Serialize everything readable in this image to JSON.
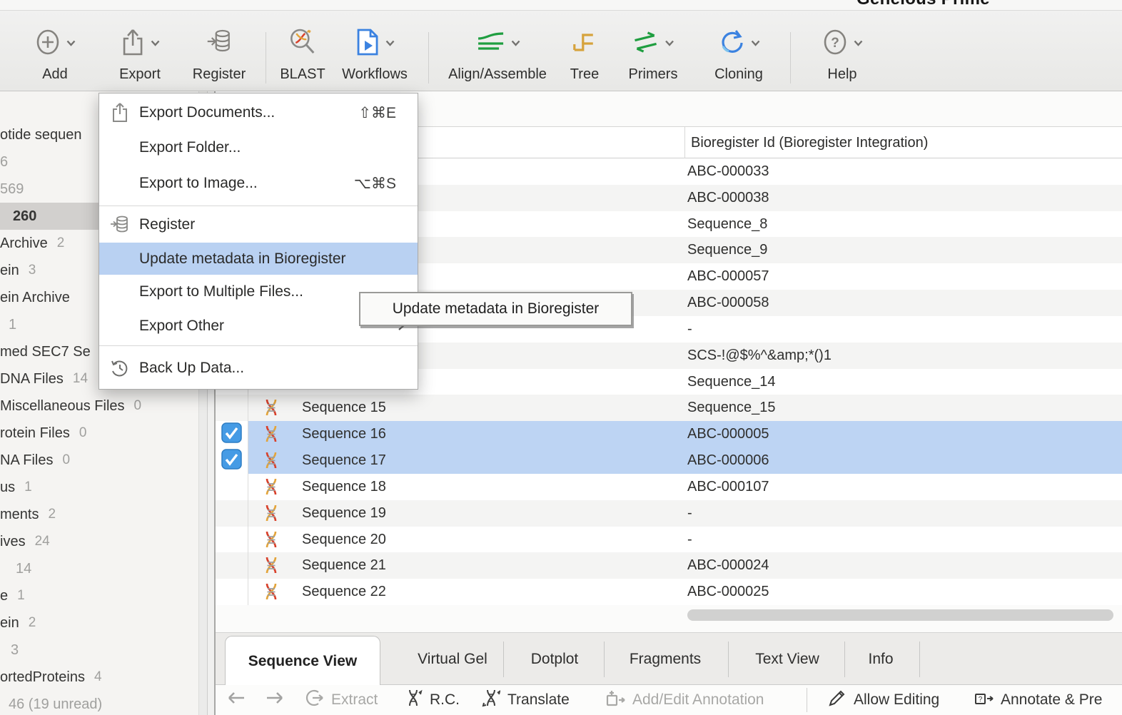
{
  "window": {
    "title": "Geneious Prime"
  },
  "toolbar": {
    "items": [
      {
        "label": "Add",
        "icon": "add-circle",
        "chevron": true
      },
      {
        "label": "Export",
        "icon": "share-up",
        "chevron": true
      },
      {
        "label": "Register",
        "icon": "database",
        "chevron": false
      },
      {
        "label": "BLAST",
        "icon": "magnifier-dna",
        "chevron": false
      },
      {
        "label": "Workflows",
        "icon": "document-play",
        "chevron": true
      },
      {
        "label": "Align/Assemble",
        "icon": "align-lines",
        "chevron": true
      },
      {
        "label": "Tree",
        "icon": "cladogram",
        "chevron": false
      },
      {
        "label": "Primers",
        "icon": "primer-arrows",
        "chevron": true
      },
      {
        "label": "Cloning",
        "icon": "circular-arrow",
        "chevron": true
      },
      {
        "label": "Help",
        "icon": "question-circle",
        "chevron": true
      }
    ]
  },
  "sidebar": {
    "items": [
      {
        "label": "otide sequen",
        "count": "",
        "muted": false,
        "selected": false
      },
      {
        "label": "6",
        "count": "",
        "muted": true,
        "selected": false
      },
      {
        "label": "569",
        "count": "",
        "muted": true,
        "selected": false
      },
      {
        "label": "260",
        "count": "",
        "muted": false,
        "selected": true
      },
      {
        "label": "Archive",
        "count": "2",
        "muted": false,
        "selected": false
      },
      {
        "label": "ein",
        "count": "3",
        "muted": false,
        "selected": false
      },
      {
        "label": "ein Archive",
        "count": "",
        "muted": false,
        "selected": false
      },
      {
        "label": "1",
        "count": "",
        "muted": true,
        "selected": false
      },
      {
        "label": "med SEC7 Se",
        "count": "",
        "muted": false,
        "selected": false
      },
      {
        "label": "DNA Files",
        "count": "14",
        "muted": false,
        "selected": false
      },
      {
        "label": "Miscellaneous Files",
        "count": "0",
        "muted": false,
        "selected": false
      },
      {
        "label": "rotein Files",
        "count": "0",
        "muted": false,
        "selected": false
      },
      {
        "label": "NA Files",
        "count": "0",
        "muted": false,
        "selected": false
      },
      {
        "label": "us",
        "count": "1",
        "muted": false,
        "selected": false
      },
      {
        "label": "ments",
        "count": "2",
        "muted": false,
        "selected": false
      },
      {
        "label": "ives",
        "count": "24",
        "muted": false,
        "selected": false
      },
      {
        "label": "14",
        "count": "",
        "muted": true,
        "selected": false
      },
      {
        "label": "e",
        "count": "1",
        "muted": false,
        "selected": false
      },
      {
        "label": "ein",
        "count": "2",
        "muted": false,
        "selected": false
      },
      {
        "label": "3",
        "count": "",
        "muted": true,
        "selected": false
      },
      {
        "label": "ortedProteins",
        "count": "4",
        "muted": false,
        "selected": false
      },
      {
        "label": "46 (19 unread)",
        "count": "",
        "muted": true,
        "selected": false
      }
    ]
  },
  "export_menu": {
    "items": [
      {
        "label": "Export Documents...",
        "shortcut": "⇧⌘E",
        "icon": "share-up"
      },
      {
        "label": "Export Folder...",
        "shortcut": ""
      },
      {
        "label": "Export to Image...",
        "shortcut": "⌥⌘S"
      },
      {
        "label": "Register",
        "icon": "database"
      },
      {
        "label": "Update metadata in Bioregister",
        "highlighted": true
      },
      {
        "label": "Export to Multiple Files...",
        "shortcut": ""
      },
      {
        "label": "Export Other",
        "submenu": true
      },
      {
        "label": "Back Up Data...",
        "icon": "history-clock"
      }
    ]
  },
  "tooltip": {
    "text": "Update metadata in Bioregister"
  },
  "table": {
    "column_header": "Bioregister Id (Bioregister Integration)",
    "rows": [
      {
        "name": "",
        "id": "ABC-000033",
        "checked": false,
        "selected": false
      },
      {
        "name": "",
        "id": "ABC-000038",
        "checked": false,
        "selected": false
      },
      {
        "name": "",
        "id": "Sequence_8",
        "checked": false,
        "selected": false
      },
      {
        "name": "",
        "id": "Sequence_9",
        "checked": false,
        "selected": false
      },
      {
        "name": "",
        "id": "ABC-000057",
        "checked": false,
        "selected": false
      },
      {
        "name": "",
        "id": "ABC-000058",
        "checked": false,
        "selected": false
      },
      {
        "name": "",
        "id": "-",
        "checked": false,
        "selected": false
      },
      {
        "name": "",
        "id": "SCS-!@$%^&amp;*()1",
        "checked": false,
        "selected": false
      },
      {
        "name": "",
        "id": "Sequence_14",
        "checked": false,
        "selected": false
      },
      {
        "name": "Sequence 15",
        "id": "Sequence_15",
        "checked": false,
        "selected": false
      },
      {
        "name": "Sequence 16",
        "id": "ABC-000005",
        "checked": true,
        "selected": true
      },
      {
        "name": "Sequence 17",
        "id": "ABC-000006",
        "checked": true,
        "selected": true
      },
      {
        "name": "Sequence 18",
        "id": "ABC-000107",
        "checked": false,
        "selected": false
      },
      {
        "name": "Sequence 19",
        "id": "-",
        "checked": false,
        "selected": false
      },
      {
        "name": "Sequence 20",
        "id": "-",
        "checked": false,
        "selected": false
      },
      {
        "name": "Sequence 21",
        "id": "ABC-000024",
        "checked": false,
        "selected": false
      },
      {
        "name": "Sequence 22",
        "id": "ABC-000025",
        "checked": false,
        "selected": false
      }
    ]
  },
  "tabs": {
    "selected": "Sequence View",
    "others": [
      "Virtual Gel",
      "Dotplot",
      "Fragments",
      "Text View",
      "Info"
    ]
  },
  "bottom_toolbar": {
    "extract": "Extract",
    "rc": "R.C.",
    "translate": "Translate",
    "add_edit_annotation": "Add/Edit Annotation",
    "allow_editing": "Allow Editing",
    "annotate_predict": "Annotate & Pre"
  }
}
